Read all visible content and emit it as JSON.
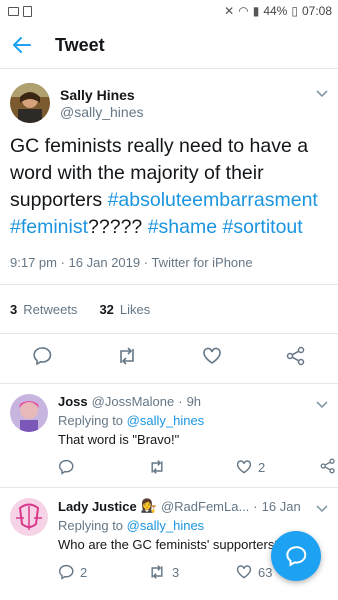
{
  "status_bar": {
    "battery": "44%",
    "time": "07:08"
  },
  "header": {
    "title": "Tweet"
  },
  "tweet": {
    "author_name": "Sally Hines",
    "author_handle": "@sally_hines",
    "text_plain_1": "GC feminists really need to have a word with the majority of their supporters ",
    "hashtag_1": "#absoluteembarrasment",
    "hashtag_2": "#feminist",
    "text_plain_2": "????? ",
    "hashtag_3": "#shame",
    "hashtag_4": "#sortitout",
    "time": "9:17 pm",
    "date": "16 Jan 2019",
    "source": "Twitter for iPhone",
    "retweets_count": "3",
    "retweets_label": "Retweets",
    "likes_count": "32",
    "likes_label": "Likes"
  },
  "replies": [
    {
      "name": "Joss",
      "handle": "@JossMalone",
      "time": "9h",
      "replying_prefix": "Replying to",
      "replying_to": "@sally_hines",
      "text": "That word is \"Bravo!\"",
      "reply_count": "",
      "retweet_count": "",
      "like_count": "2"
    },
    {
      "name": "Lady Justice",
      "handle": "@RadFemLa...",
      "time": "16 Jan",
      "replying_prefix": "Replying to",
      "replying_to": "@sally_hines",
      "text": "Who are the GC feminists' supporters?",
      "reply_count": "2",
      "retweet_count": "3",
      "like_count": "63"
    }
  ],
  "colors": {
    "accent": "#1da1f2",
    "link": "#1b95e0",
    "secondary": "#657786"
  }
}
